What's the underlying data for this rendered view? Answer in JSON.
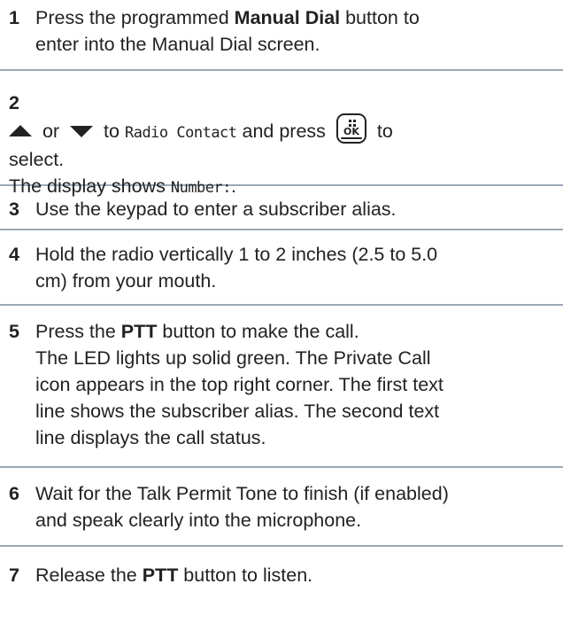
{
  "steps": [
    {
      "number": "1",
      "line1_pre": "Press the programmed ",
      "line1_bold": "Manual Dial",
      "line1_post": " button to",
      "line2": "enter into the Manual Dial screen."
    },
    {
      "number": "2",
      "or": " or ",
      "to": " to ",
      "menu_item": "Radio Contact",
      "and_press": " and press ",
      "button_label": "OK",
      "to2": " to",
      "line2": "select.",
      "line3_pre": "The display shows ",
      "display_text": "Number:",
      "line3_post": "."
    },
    {
      "number": "3",
      "line1": "Use the keypad to enter a subscriber alias."
    },
    {
      "number": "4",
      "line1": "Hold the radio vertically 1 to 2 inches (2.5 to 5.0",
      "line2": "cm) from your mouth."
    },
    {
      "number": "5",
      "line1_pre": "Press the ",
      "line1_bold": "PTT",
      "line1_post": " button to make the call.",
      "lines": [
        "The LED lights up solid green. The Private Call",
        "icon appears in the top right corner. The first text",
        "line shows the subscriber alias. The second text",
        "line displays the call status."
      ]
    },
    {
      "number": "6",
      "line1": "Wait for the Talk Permit Tone to finish (if enabled)",
      "line2": "and speak clearly into the microphone."
    },
    {
      "number": "7",
      "line1_pre": "Release the ",
      "line1_bold": "PTT",
      "line1_post": " button to listen."
    }
  ]
}
